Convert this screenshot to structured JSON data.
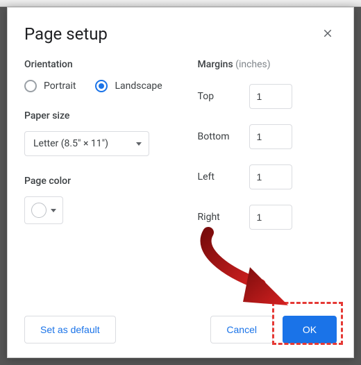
{
  "dialog": {
    "title": "Page setup"
  },
  "orientation": {
    "label": "Orientation",
    "portrait": "Portrait",
    "landscape": "Landscape",
    "selected": "landscape"
  },
  "paperSize": {
    "label": "Paper size",
    "value": "Letter (8.5\" × 11\")"
  },
  "pageColor": {
    "label": "Page color",
    "value": "#ffffff"
  },
  "margins": {
    "label": "Margins",
    "units": "(inches)",
    "top": {
      "label": "Top",
      "value": "1"
    },
    "bottom": {
      "label": "Bottom",
      "value": "1"
    },
    "left": {
      "label": "Left",
      "value": "1"
    },
    "right": {
      "label": "Right",
      "value": "1"
    }
  },
  "buttons": {
    "setDefault": "Set as default",
    "cancel": "Cancel",
    "ok": "OK"
  },
  "annotation": {
    "highlightColor": "#e53935",
    "arrowColor": "#b71c1c"
  }
}
